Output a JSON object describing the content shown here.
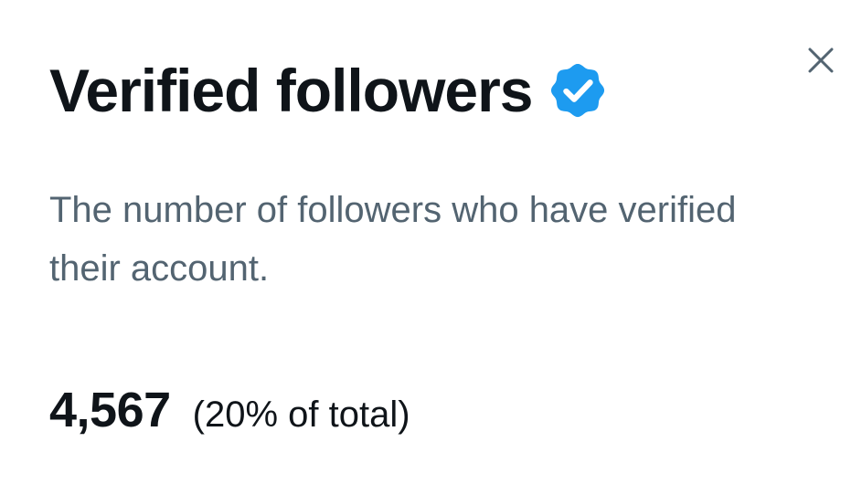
{
  "dialog": {
    "title": "Verified followers",
    "badge_icon": "verified-badge-icon",
    "close_icon": "close-icon",
    "description": "The number of followers who have verified their account.",
    "stat": {
      "value": "4,567",
      "share": "(20% of total)"
    }
  },
  "colors": {
    "title": "#0f1419",
    "description": "#536471",
    "badge": "#1d9bf0",
    "close_icon": "#536471",
    "background": "#ffffff"
  }
}
